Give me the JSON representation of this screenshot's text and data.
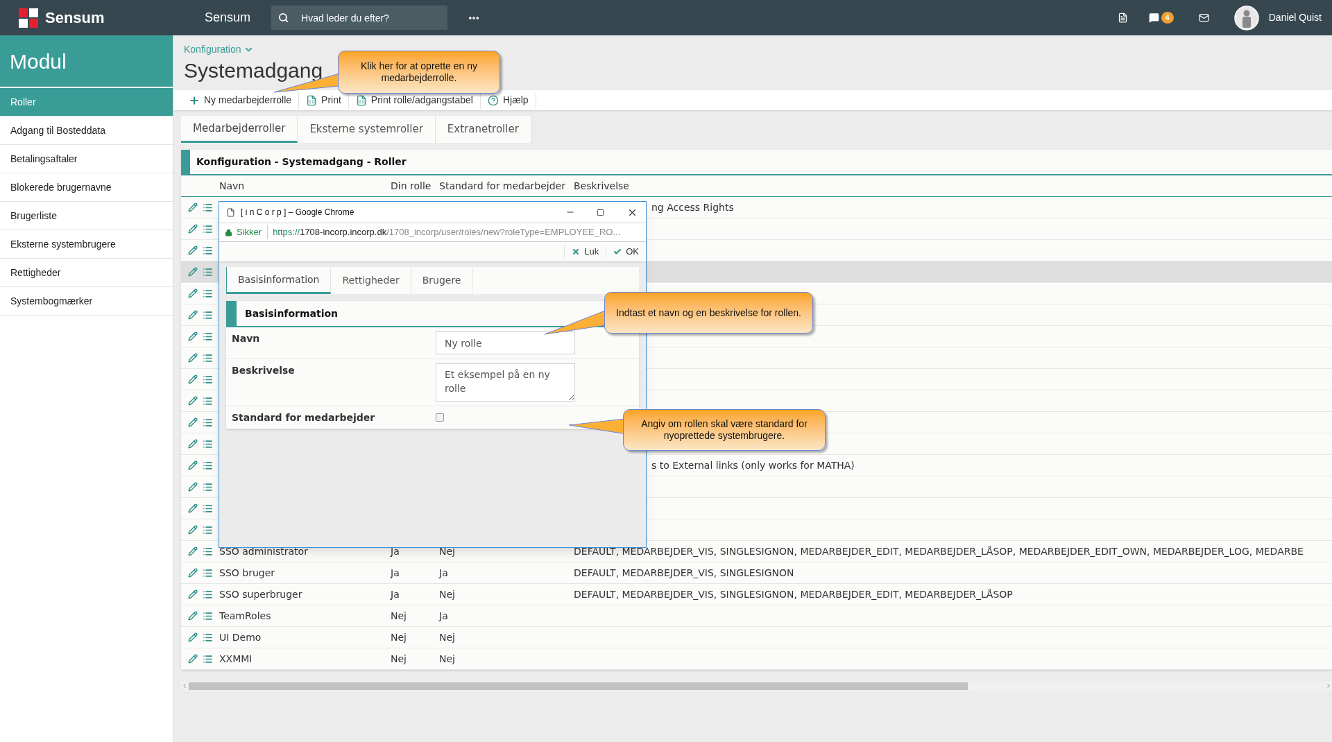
{
  "topbar": {
    "logo_text": "Sensum",
    "app_name": "Sensum",
    "search": {
      "placeholder": "Hvad leder du efter?"
    },
    "chat_badge": "4",
    "user": "Daniel Quist"
  },
  "sidebar": {
    "title": "Modul",
    "items": [
      {
        "label": "Roller",
        "selected": true
      },
      {
        "label": "Adgang til Bosteddata",
        "selected": false
      },
      {
        "label": "Betalingsaftaler",
        "selected": false
      },
      {
        "label": "Blokerede brugernavne",
        "selected": false
      },
      {
        "label": "Brugerliste",
        "selected": false
      },
      {
        "label": "Eksterne systembrugere",
        "selected": false
      },
      {
        "label": "Rettigheder",
        "selected": false
      },
      {
        "label": "Systembogmærker",
        "selected": false
      }
    ]
  },
  "breadcrumb": "Konfiguration",
  "title": "Systemadgang",
  "toolbar": [
    {
      "kind": "add",
      "label": "Ny medarbejderrolle"
    },
    {
      "kind": "excel",
      "label": "Print"
    },
    {
      "kind": "excel",
      "label": "Print rolle/adgangstabel"
    },
    {
      "kind": "help",
      "label": "Hjælp"
    }
  ],
  "tabs": [
    {
      "label": "Medarbejderroller",
      "selected": true
    },
    {
      "label": "Eksterne systemroller",
      "selected": false
    },
    {
      "label": "Extranetroller",
      "selected": false
    }
  ],
  "section_title": "Konfiguration - Systemadgang - Roller",
  "table": {
    "columns": [
      "Navn",
      "Din rolle",
      "Standard for medarbejder",
      "Beskrivelse"
    ],
    "rows": [
      {
        "selected": false,
        "description": "ng Access Rights"
      },
      {
        "selected": false
      },
      {
        "selected": false
      },
      {
        "selected": true
      },
      {
        "selected": false
      },
      {
        "selected": false
      },
      {
        "selected": false
      },
      {
        "selected": false
      },
      {
        "selected": false
      },
      {
        "selected": false
      },
      {
        "selected": false
      },
      {
        "selected": false
      },
      {
        "selected": false,
        "description": "s to External links (only works for MATHA)"
      },
      {
        "selected": false
      },
      {
        "selected": false
      },
      {
        "selected": false
      },
      {
        "selected": false,
        "name": "SSO administrator",
        "din_rolle": "Ja",
        "standard": "Nej",
        "description": "DEFAULT, MEDARBEJDER_VIS, SINGLESIGNON, MEDARBEJDER_EDIT, MEDARBEJDER_LÅSOP, MEDARBEJDER_EDIT_OWN, MEDARBEJDER_LOG, MEDARBE"
      },
      {
        "selected": false,
        "name": "SSO bruger",
        "din_rolle": "Ja",
        "standard": "Ja",
        "description": "DEFAULT, MEDARBEJDER_VIS, SINGLESIGNON"
      },
      {
        "selected": false,
        "name": "SSO superbruger",
        "din_rolle": "Ja",
        "standard": "Nej",
        "description": "DEFAULT, MEDARBEJDER_VIS, SINGLESIGNON, MEDARBEJDER_EDIT, MEDARBEJDER_LÅSOP"
      },
      {
        "selected": false,
        "name": "TeamRoles",
        "din_rolle": "Nej",
        "standard": "Ja"
      },
      {
        "selected": false,
        "name": "UI Demo",
        "din_rolle": "Nej",
        "standard": "Nej"
      },
      {
        "selected": false,
        "name": "XXMMI",
        "din_rolle": "Nej",
        "standard": "Nej"
      }
    ]
  },
  "popup": {
    "window_title": "[ i n C o r p ] – Google Chrome",
    "secure_label": "Sikker",
    "url": {
      "scheme": "https://",
      "host": "1708-incorp.incorp.dk",
      "path": "/1708_incorp/user/roles/new?roleType=EMPLOYEE_RO..."
    },
    "actions": [
      {
        "kind": "close",
        "label": "Luk"
      },
      {
        "kind": "ok",
        "label": "OK"
      }
    ],
    "tabs": [
      {
        "label": "Basisinformation",
        "selected": true
      },
      {
        "label": "Rettigheder",
        "selected": false
      },
      {
        "label": "Brugere",
        "selected": false
      }
    ],
    "section_title": "Basisinformation",
    "fields": [
      {
        "kind": "text",
        "label": "Navn",
        "value": "Ny rolle"
      },
      {
        "kind": "textarea",
        "label": "Beskrivelse",
        "value": "Et eksempel på en ny rolle"
      },
      {
        "kind": "checkbox",
        "label": "Standard for medarbejder",
        "checked": false
      }
    ]
  },
  "callouts": [
    {
      "text": "Klik her for at oprette en ny medarbejderrolle."
    },
    {
      "text": "Indtast et navn og en beskrivelse for rollen."
    },
    {
      "text": "Angiv om rollen skal være standard for nyoprettede systembrugere."
    }
  ]
}
